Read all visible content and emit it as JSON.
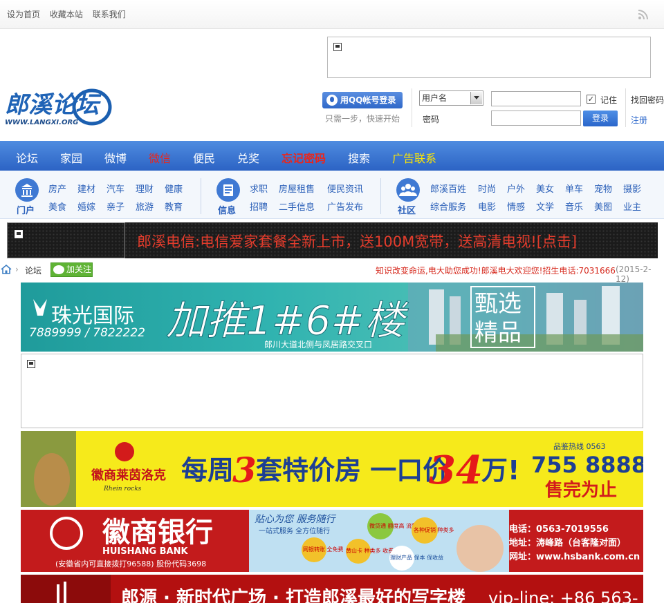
{
  "topbar": {
    "links": [
      "设为首页",
      "收藏本站",
      "联系我们"
    ]
  },
  "logo": {
    "main": "郎溪论坛",
    "url": "WWW.LANGXI.ORG"
  },
  "login": {
    "qq_button": "用QQ帐号登录",
    "qq_sub": "只需一步，快速开始",
    "username_select": "用户名",
    "password_label": "密码",
    "remember": "记住",
    "login_button": "登录",
    "forgot": "找回密码",
    "register": "注册"
  },
  "nav": [
    {
      "label": "论坛",
      "color": "#ffffff"
    },
    {
      "label": "家园",
      "color": "#ffffff"
    },
    {
      "label": "微博",
      "color": "#ffffff"
    },
    {
      "label": "微信",
      "color": "#e8261d"
    },
    {
      "label": "便民",
      "color": "#ffffff"
    },
    {
      "label": "兑奖",
      "color": "#ffffff"
    },
    {
      "label": "忘记密码",
      "color": "#e8261d"
    },
    {
      "label": "搜索",
      "color": "#ffffff"
    },
    {
      "label": "广告联系",
      "color": "#ffe600"
    }
  ],
  "subnav": {
    "portal": {
      "label": "门户",
      "links": [
        "房产",
        "建材",
        "汽车",
        "理财",
        "健康",
        "美食",
        "婚嫁",
        "亲子",
        "旅游",
        "教育"
      ]
    },
    "info": {
      "label": "信息",
      "links": [
        "求职",
        "房屋租售",
        "便民资讯",
        "招聘",
        "二手信息",
        "广告发布"
      ]
    },
    "community": {
      "label": "社区",
      "links": [
        "郎溪百姓",
        "时尚",
        "户外",
        "美女",
        "单车",
        "宠物",
        "摄影",
        "综合服务",
        "电影",
        "情感",
        "文学",
        "音乐",
        "美图",
        "业主"
      ]
    }
  },
  "ticker": {
    "text": "郎溪电信:电信爱家套餐全新上市，送100M宽带，送高清电视![点击]"
  },
  "breadcrumb": {
    "label": "论坛",
    "follow": "加关注",
    "notice": "知识改变命运,电大助您成功!郎溪电大欢迎您!招生电话:7031666",
    "date": "(2015-2-12)"
  },
  "banners": {
    "b1": {
      "brand": "珠光国际",
      "phone": "7889999 / 7822222",
      "headline": "加推1#6#楼",
      "tag1": "甄选",
      "tag2": "精品",
      "address": "郎川大道北侧与凤居路交叉口"
    },
    "b3": {
      "brand": "徽商莱茵洛克",
      "brand_en": "Rhein rocks",
      "text1": "每周",
      "num1": "3",
      "text2": "套特价房 一口价",
      "num2": "34",
      "text3": "万!",
      "hotline_label": "品鉴热线 0563",
      "phone": "755 8888",
      "soldout": "售完为止"
    },
    "b4": {
      "bank_cn": "徽商银行",
      "bank_en": "HUISHANG BANK",
      "note": "(安徽省内可直接拨打96588) 股份代码3698",
      "slogan": "贴心为您 服务随行",
      "sub_slogan": "一站式服务 全方位随行",
      "bubbles": [
        "微贷通 额度高 流程快",
        "各种促销 种类多",
        "网银转账 全免费",
        "黄山卡 种类多 收费少",
        "理财产品 保本 保收益"
      ],
      "tel": "电话：0563-7019556",
      "addr": "地址：涛峰路（台客隆对面）",
      "web": "网址：www.hsbank.com.cn"
    },
    "b5": {
      "text": "郎源 · 新时代广场 · 打造郎溪最好的写字楼",
      "vip": "vip-line: +86 563-"
    }
  },
  "colors": {
    "nav_bg": "#3a74d4",
    "accent_red": "#e8261d",
    "link_blue": "#2a5fb8"
  }
}
